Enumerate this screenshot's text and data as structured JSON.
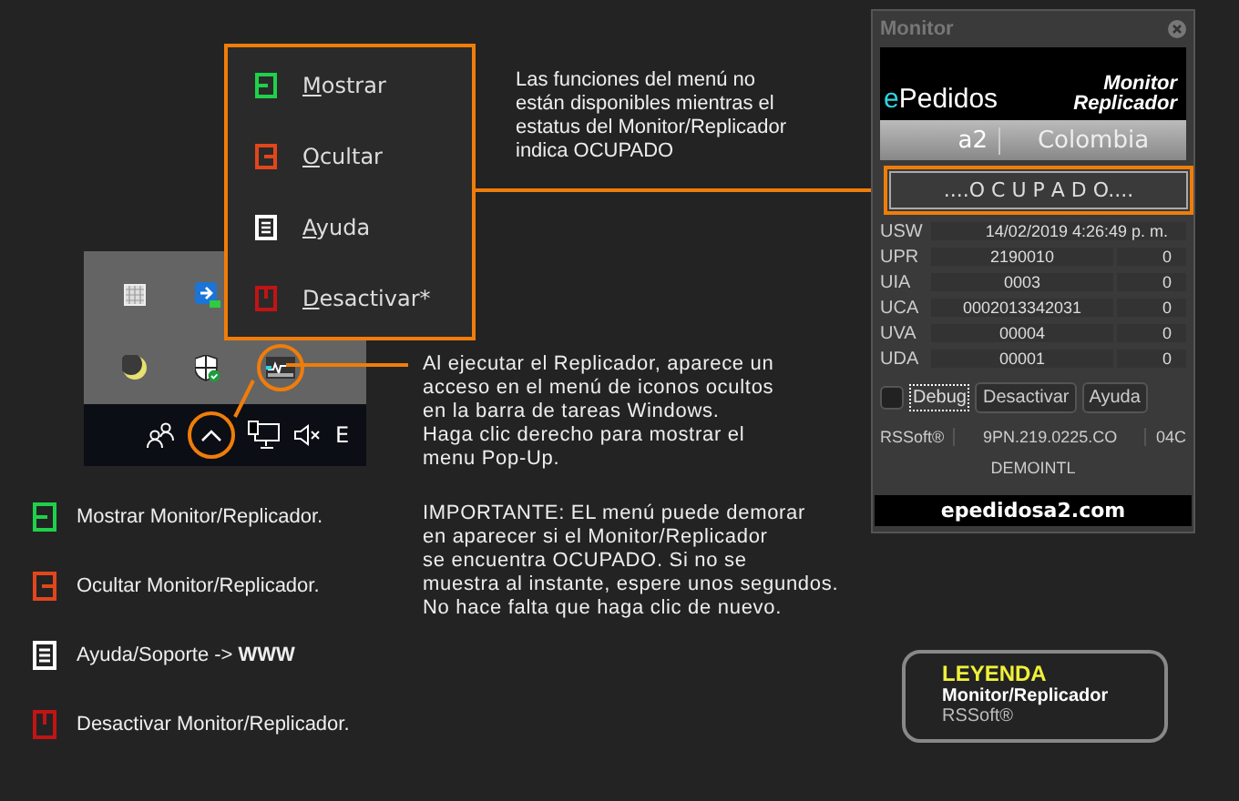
{
  "popup_menu": {
    "items": [
      {
        "kind": "show",
        "label": "Mostrar"
      },
      {
        "kind": "hide",
        "label": "Ocultar"
      },
      {
        "kind": "help",
        "label": "Ayuda"
      },
      {
        "kind": "off",
        "label": "Desactivar*"
      }
    ]
  },
  "menu_note": "Las funciones del menú no\nestán disponibles mientras el\nestatus del Monitor/Replicador\nindica OCUPADO",
  "taskbar": {
    "language": "E"
  },
  "tray_note": "Al ejecutar el Replicador, aparece un\nacceso en el menú de iconos ocultos\nen la barra de tareas Windows.\nHaga clic derecho para mostrar el\nmenu Pop-Up.",
  "important_note": "IMPORTANTE: EL menú puede demorar\nen aparecer si el Monitor/Replicador\nse encuentra OCUPADO. Si no se\nmuestra al instante, espere unos segundos.\nNo hace falta que haga clic de nuevo.",
  "legend_items": [
    {
      "kind": "show",
      "text": "Mostrar Monitor/Replicador."
    },
    {
      "kind": "hide",
      "text": "Ocultar  Monitor/Replicador."
    },
    {
      "kind": "help",
      "text": "Ayuda/Soporte -> **WWW**"
    },
    {
      "kind": "off",
      "text": "Desactivar Monitor/Replicador."
    }
  ],
  "monitor": {
    "title": "Monitor",
    "logo_prefix": "e",
    "logo_name": "Pedidos",
    "product": [
      "Monitor",
      "Replicador"
    ],
    "edition": "a2",
    "country": "Colombia",
    "status": "....O C U P A D O....",
    "rows": [
      {
        "label": "USW",
        "value": "14/02/2019 4:26:49 p. m."
      },
      {
        "label": "UPR",
        "value": "2190010",
        "count": "0"
      },
      {
        "label": "UIA",
        "value": "0003",
        "count": "0"
      },
      {
        "label": "UCA",
        "value": "0002013342031",
        "count": "0"
      },
      {
        "label": "UVA",
        "value": "00004",
        "count": "0"
      },
      {
        "label": "UDA",
        "value": "00001",
        "count": "0"
      }
    ],
    "debug": {
      "label": "Debug",
      "checked": false
    },
    "buttons": [
      "Desactivar",
      "Ayuda"
    ],
    "footer": [
      "RSSoft®",
      "9PN.219.0225.CO",
      "04C"
    ],
    "license": "DEMOINTL",
    "website": "epedidosa2.com"
  },
  "legend_box": {
    "title": "LEYENDA",
    "subtitle": "Monitor/Replicador",
    "brand": "RSSoft®"
  }
}
